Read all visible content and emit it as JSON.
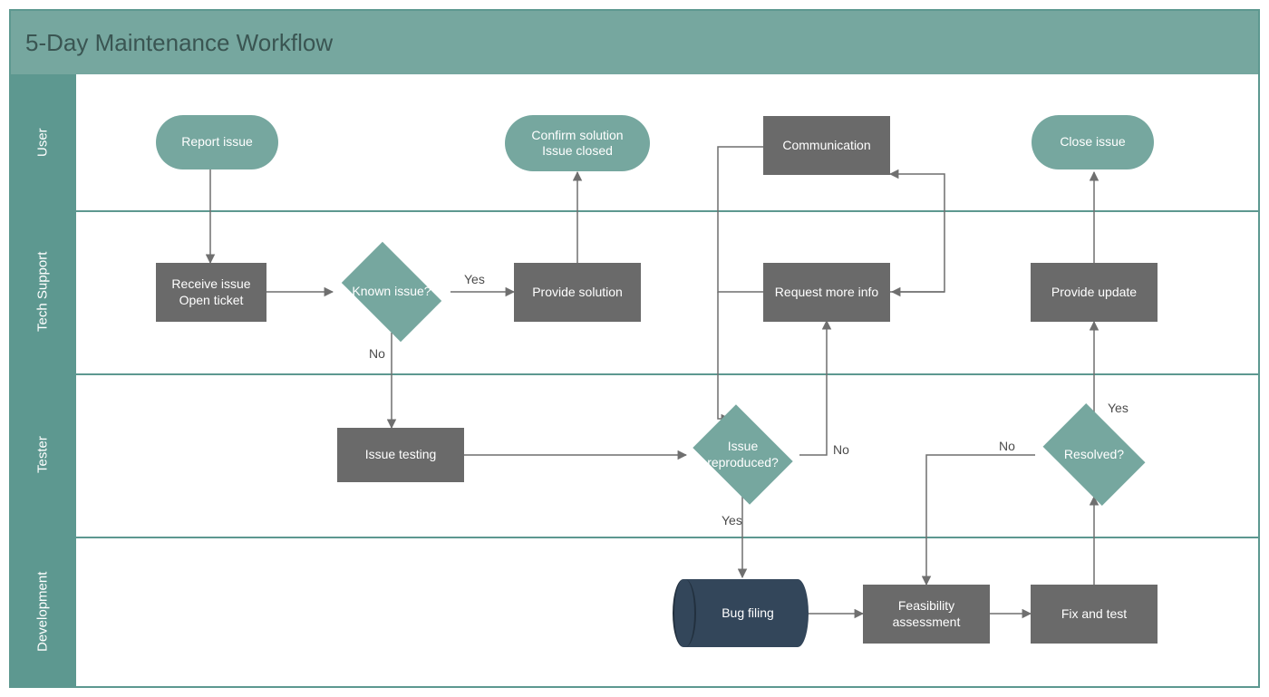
{
  "title": "5-Day Maintenance Workflow",
  "lanes": {
    "user": "User",
    "tech_support": "Tech Support",
    "tester": "Tester",
    "development": "Development"
  },
  "nodes": {
    "report_issue": "Report issue",
    "confirm_solution_l1": "Confirm solution",
    "confirm_solution_l2": "Issue closed",
    "communication": "Communication",
    "close_issue": "Close issue",
    "receive_issue_l1": "Receive issue",
    "receive_issue_l2": "Open ticket",
    "known_issue": "Known issue?",
    "provide_solution": "Provide solution",
    "request_more_info": "Request more info",
    "provide_update": "Provide update",
    "issue_testing": "Issue testing",
    "issue_reproduced_l1": "Issue",
    "issue_reproduced_l2": "reproduced?",
    "resolved": "Resolved?",
    "bug_filing": "Bug filing",
    "feasibility_l1": "Feasibility",
    "feasibility_l2": "assessment",
    "fix_and_test": "Fix and test"
  },
  "edge_labels": {
    "known_yes": "Yes",
    "known_no": "No",
    "reproduced_no": "No",
    "reproduced_yes": "Yes",
    "resolved_yes": "Yes",
    "resolved_no": "No"
  },
  "colors": {
    "lane": "#5d9890",
    "terminator": "#76a79f",
    "process": "#6a6a6a",
    "cylinder": "#33465a",
    "arrow": "#6f6f6f"
  }
}
